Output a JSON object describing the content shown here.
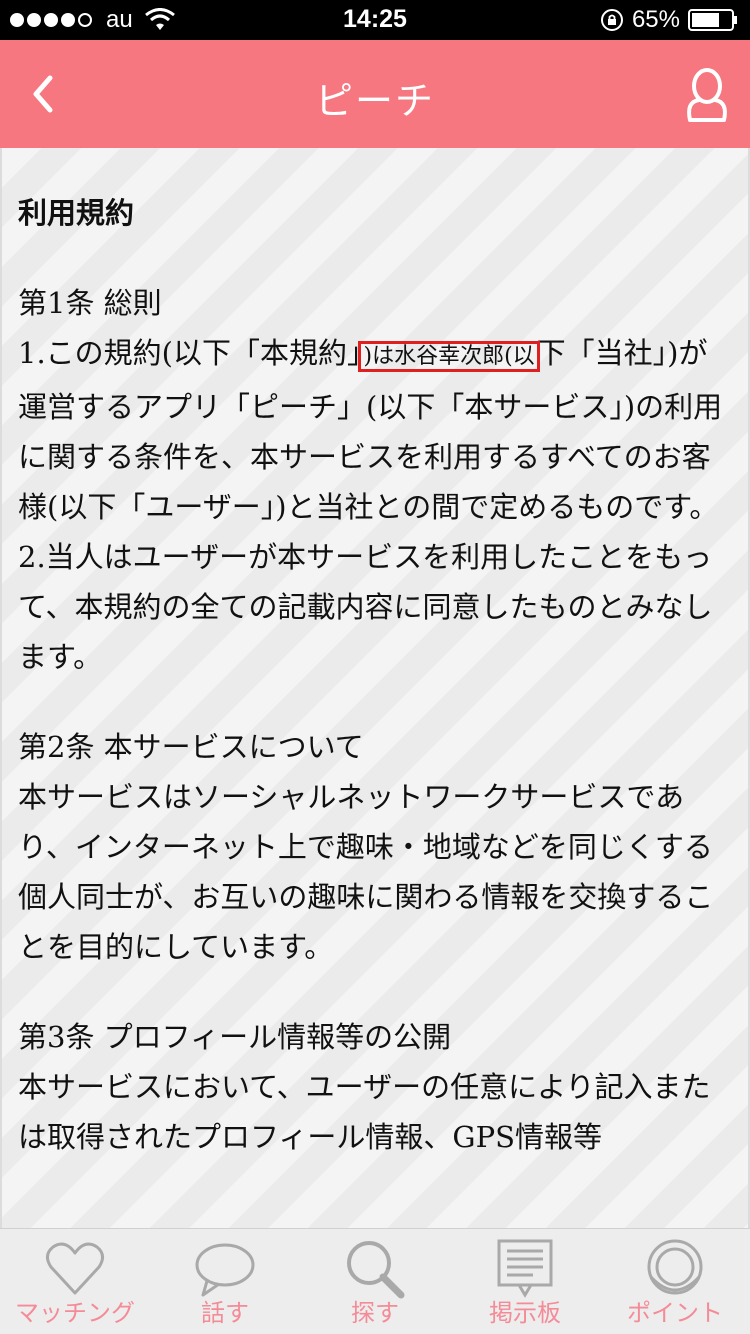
{
  "status_bar": {
    "carrier": "au",
    "time": "14:25",
    "battery": "65%"
  },
  "nav": {
    "title": "ピーチ"
  },
  "content": {
    "heading": "利用規約",
    "article1": {
      "title": "第1条 総則",
      "p1_before": "1.この規約(以下「本規約」",
      "p1_highlight": ")は水谷幸次郎(以",
      "p1_after": "下「当社」)が運営するアプリ「ピーチ」(以下「本サービス」)の利用に関する条件を、本サービスを利用するすべてのお客様(以下「ユーザー」)と当社との間で定めるものです。",
      "p2": "2.当人はユーザーが本サービスを利用したことをもって、本規約の全ての記載内容に同意したものとみなします。"
    },
    "article2": {
      "title": "第2条 本サービスについて",
      "body": "本サービスはソーシャルネットワークサービスであり、インターネット上で趣味・地域などを同じくする個人同士が、お互いの趣味に関わる情報を交換することを目的にしています。"
    },
    "article3": {
      "title": "第3条 プロフィール情報等の公開",
      "body": "本サービスにおいて、ユーザーの任意により記入または取得されたプロフィール情報、GPS情報等"
    }
  },
  "tabs": [
    {
      "label": "マッチング",
      "icon": "heart-icon"
    },
    {
      "label": "話す",
      "icon": "speech-bubble-icon"
    },
    {
      "label": "探す",
      "icon": "search-icon"
    },
    {
      "label": "掲示板",
      "icon": "bulletin-board-icon"
    },
    {
      "label": "ポイント",
      "icon": "coin-icon"
    }
  ],
  "colors": {
    "nav_bg": "#f6777f",
    "tab_label": "#f48c98",
    "highlight_box": "#e02020"
  }
}
